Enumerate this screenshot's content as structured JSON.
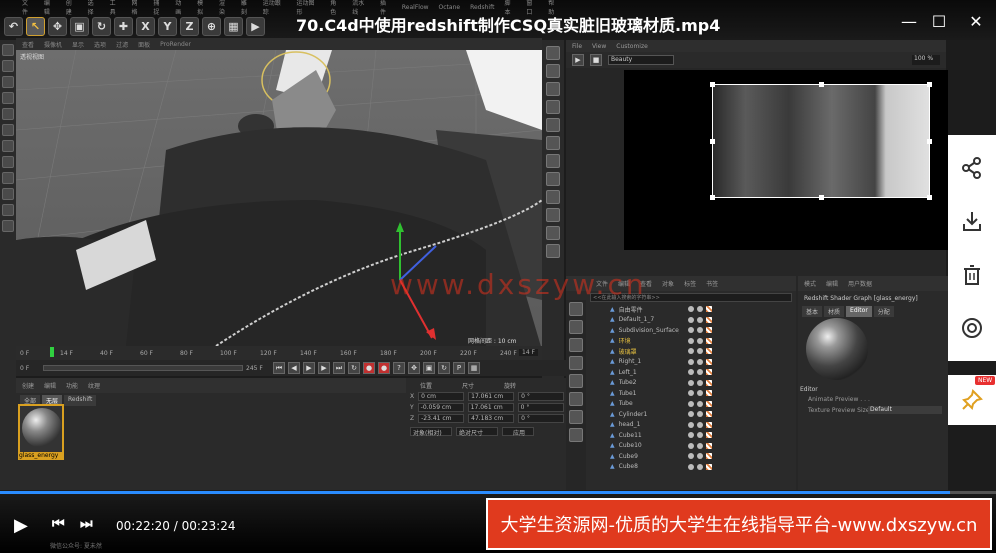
{
  "app": {
    "title": "70.C4d中使用redshift制作CSQ真实脏旧玻璃材质.mp4",
    "menu": [
      "文件",
      "编辑",
      "创建",
      "选择",
      "工具",
      "网格",
      "捕捉",
      "动画",
      "模拟",
      "渲染",
      "雕刻",
      "运动跟踪",
      "运动图形",
      "角色",
      "流水线",
      "插件",
      "RealFlow",
      "Octane",
      "Redshift",
      "脚本",
      "窗口",
      "帮助"
    ]
  },
  "toolbar": {
    "axis_x": "X",
    "axis_y": "Y",
    "axis_z": "Z"
  },
  "viewport": {
    "menu": [
      "查看",
      "摄像机",
      "显示",
      "选项",
      "过滤",
      "面板",
      "ProRender"
    ],
    "label": "透视视图",
    "grid_spacing": "网格间距 : 10 cm"
  },
  "timeline": {
    "ticks": [
      "0 F",
      "14 F",
      "40 F",
      "60 F",
      "80 F",
      "100 F",
      "120 F",
      "140 F",
      "160 F",
      "180 F",
      "200 F",
      "220 F",
      "240 F"
    ],
    "current_frame": "14 F",
    "start": "0 F",
    "end": "245 F",
    "end2": "245 F"
  },
  "materials": {
    "menu": [
      "创建",
      "编辑",
      "功能",
      "纹理"
    ],
    "tabs": [
      "全部",
      "无层",
      "Redshift"
    ],
    "items": [
      {
        "name": "glass_energy"
      }
    ]
  },
  "coordinates": {
    "headers": [
      "位置",
      "尺寸",
      "旋转"
    ],
    "rows": [
      {
        "axis": "X",
        "pos": "0 cm",
        "size": "17.061 cm",
        "rot": "0 °"
      },
      {
        "axis": "Y",
        "pos": "-0.059 cm",
        "size": "17.061 cm",
        "rot": "0 °"
      },
      {
        "axis": "Z",
        "pos": "-23.41 cm",
        "size": "47.183 cm",
        "rot": "0 °"
      }
    ],
    "mode1": "对象(相对)",
    "mode2": "绝对尺寸",
    "apply": "应用"
  },
  "renderview": {
    "menu": [
      "File",
      "View",
      "Customize"
    ],
    "aov": "Beauty",
    "zoom": "100 %"
  },
  "objects": {
    "tabs": [
      "文件",
      "编辑",
      "查看",
      "对象",
      "标签",
      "书签"
    ],
    "search": "<<在此输入搜索的字符串>>",
    "items": [
      {
        "name": "自由零件",
        "hl": false
      },
      {
        "name": "Default_1_7",
        "hl": false
      },
      {
        "name": "Subdivision_Surface_2",
        "hl": false
      },
      {
        "name": "环境",
        "hl": true
      },
      {
        "name": "玻璃罩",
        "hl": true
      },
      {
        "name": "Right_1",
        "hl": false
      },
      {
        "name": "Left_1",
        "hl": false
      },
      {
        "name": "Tube2",
        "hl": false
      },
      {
        "name": "Tube1",
        "hl": false
      },
      {
        "name": "Tube",
        "hl": false
      },
      {
        "name": "Cylinder1",
        "hl": false
      },
      {
        "name": "head_1",
        "hl": false
      },
      {
        "name": "Cube11",
        "hl": false
      },
      {
        "name": "Cube10",
        "hl": false
      },
      {
        "name": "Cube9",
        "hl": false
      },
      {
        "name": "Cube8",
        "hl": false
      }
    ]
  },
  "attributes": {
    "tabs": [
      "模式",
      "编辑",
      "用户数据"
    ],
    "header": "Redshift Shader Graph [glass_energy]",
    "subtabs": [
      "基本",
      "材质",
      "Editor",
      "分配"
    ],
    "section": "Editor",
    "animate_preview": "Animate Preview . . .",
    "texture_preview_size": "Texture Preview Size",
    "texture_preview_value": "Default"
  },
  "sidebar": {
    "new_badge": "NEW"
  },
  "player": {
    "current_time": "00:22:20",
    "duration": "00:23:24",
    "progress": 0.954
  },
  "banner": {
    "text": "大学生资源网-优质的大学生在线指导平台-www.dxszyw.cn"
  },
  "watermark": "www.dxszyw.cn",
  "statusbar": "微信公众号: 夏未然"
}
